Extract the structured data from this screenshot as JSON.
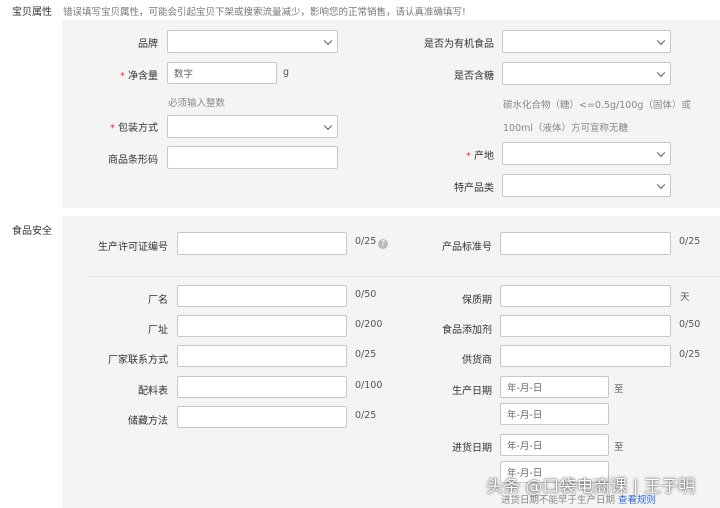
{
  "attributes": {
    "section_label": "宝贝属性",
    "warning": "错误填写宝贝属性，可能会引起宝贝下架或搜索流量减少，影响您的正常销售，请认真准确填写!",
    "brand": {
      "label": "品牌"
    },
    "net_content": {
      "label": "净含量",
      "placeholder": "数字",
      "unit": "g",
      "hint": "必须输入整数"
    },
    "packaging": {
      "label": "包装方式"
    },
    "barcode": {
      "label": "商品条形码"
    },
    "organic": {
      "label": "是否为有机食品"
    },
    "sugar": {
      "label": "是否含糖",
      "hint_line1": "碳水化合物（糖）<=0.5g/100g（固体）或",
      "hint_line2": "100ml（液体）方可宣称无糖"
    },
    "origin": {
      "label": "产地"
    },
    "specialty": {
      "label": "特产品类"
    }
  },
  "food_safety": {
    "section_label": "食品安全",
    "license_no": {
      "label": "生产许可证编号",
      "count": "0/25"
    },
    "standard_no": {
      "label": "产品标准号",
      "count": "0/25"
    },
    "factory_name": {
      "label": "厂名",
      "count": "0/50"
    },
    "factory_address": {
      "label": "厂址",
      "count": "0/200"
    },
    "factory_contact": {
      "label": "厂家联系方式",
      "count": "0/25"
    },
    "ingredients": {
      "label": "配料表",
      "count": "0/100"
    },
    "storage": {
      "label": "储藏方法",
      "count": "0/25"
    },
    "shelf_life": {
      "label": "保质期",
      "unit": "天"
    },
    "additives": {
      "label": "食品添加剂",
      "count": "0/50"
    },
    "supplier": {
      "label": "供货商",
      "count": "0/25"
    },
    "production_date": {
      "label": "生产日期",
      "start_placeholder": "年-月-日",
      "to": "至",
      "end_placeholder": "年-月-日"
    },
    "purchase_date": {
      "label": "进货日期",
      "start_placeholder": "年-月-日",
      "to": "至",
      "end_placeholder": "年-月-日",
      "note": "进货日期不能早于生产日期",
      "rules_link": "查看规则"
    }
  },
  "watermark": "头条 @口袋电商课 | 王子明"
}
